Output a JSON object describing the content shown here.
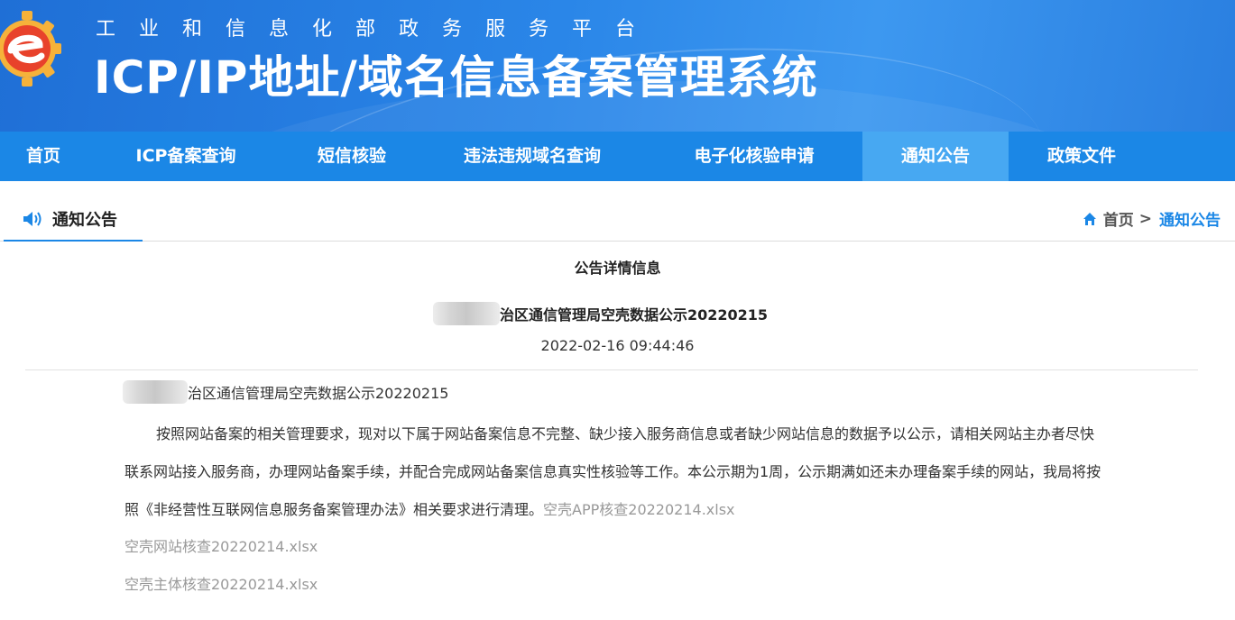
{
  "header": {
    "subtitle": "工业和信息化部政务服务平台",
    "title": "ICP/IP地址/域名信息备案管理系统"
  },
  "nav": {
    "items": [
      {
        "label": "首页"
      },
      {
        "label": "ICP备案查询"
      },
      {
        "label": "短信核验"
      },
      {
        "label": "违法违规域名查询"
      },
      {
        "label": "电子化核验申请"
      },
      {
        "label": "通知公告",
        "active": true
      },
      {
        "label": "政策文件"
      }
    ]
  },
  "section": {
    "title": "通知公告",
    "breadcrumb": {
      "home": "首页",
      "separator": ">",
      "current": "通知公告"
    }
  },
  "notice": {
    "detail_heading": "公告详情信息",
    "title_suffix": "治区通信管理局空壳数据公示20220215",
    "date": "2022-02-16 09:44:46",
    "body_line1_suffix": "治区通信管理局空壳数据公示20220215",
    "paragraph": "按照网站备案的相关管理要求，现对以下属于网站备案信息不完整、缺少接入服务商信息或者缺少网站信息的数据予以公示，请相关网站主办者尽快联系网站接入服务商，办理网站备案手续，并配合完成网站备案信息真实性核验等工作。本公示期为1周，公示期满如还未办理备案手续的网站，我局将按照《非经营性互联网信息服务备案管理办法》相关要求进行清理。",
    "attachments": [
      {
        "name": "空壳APP核查20220214.xlsx"
      },
      {
        "name": "空壳网站核查20220214.xlsx"
      },
      {
        "name": "空壳主体核查20220214.xlsx"
      }
    ]
  },
  "colors": {
    "nav_bg": "#1b87e6",
    "nav_active_bg": "#47a8f2",
    "accent": "#1b87e6",
    "attachment_text": "#999999"
  },
  "icons": {
    "logo": "e-logo-icon",
    "section": "speaker-icon",
    "breadcrumb_home": "home-icon"
  }
}
